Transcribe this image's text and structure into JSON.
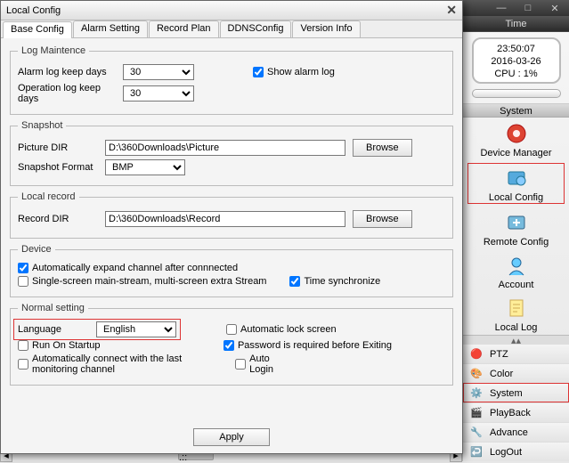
{
  "window": {
    "title": "Local Config",
    "tabs": [
      "Base Config",
      "Alarm Setting",
      "Record Plan",
      "DDNSConfig",
      "Version Info"
    ],
    "active_tab": 0
  },
  "log": {
    "legend": "Log Maintence",
    "alarm_label": "Alarm log keep days",
    "alarm_value": "30",
    "op_label": "Operation log keep days",
    "op_value": "30",
    "show_alarm_label": "Show alarm log",
    "show_alarm_checked": true
  },
  "snapshot": {
    "legend": "Snapshot",
    "dir_label": "Picture DIR",
    "dir_value": "D:\\360Downloads\\Picture",
    "fmt_label": "Snapshot Format",
    "fmt_value": "BMP",
    "browse": "Browse"
  },
  "localrec": {
    "legend": "Local record",
    "dir_label": "Record DIR",
    "dir_value": "D:\\360Downloads\\Record",
    "browse": "Browse"
  },
  "device": {
    "legend": "Device",
    "auto_expand": "Automatically expand channel after connnected",
    "auto_expand_checked": true,
    "single_screen": "Single-screen main-stream, multi-screen extra Stream",
    "single_screen_checked": false,
    "time_sync": "Time synchronize",
    "time_sync_checked": true
  },
  "normal": {
    "legend": "Normal setting",
    "lang_label": "Language",
    "lang_value": "English",
    "auto_lock": "Automatic lock screen",
    "auto_lock_checked": false,
    "run_startup": "Run On Startup",
    "run_startup_checked": false,
    "pwd_exit": "Password is required before Exiting",
    "pwd_exit_checked": true,
    "auto_connect": "Automatically connect with the last monitoring channel",
    "auto_connect_checked": false,
    "auto_login": "Auto Login",
    "auto_login_checked": false
  },
  "apply": "Apply",
  "rp": {
    "time_header": "Time",
    "clock": "23:50:07",
    "date": "2016-03-26",
    "cpu": "CPU : 1%",
    "system_header": "System",
    "items": [
      {
        "label": "Device Manager"
      },
      {
        "label": "Local Config"
      },
      {
        "label": "Remote Config"
      },
      {
        "label": "Account"
      },
      {
        "label": "Local Log"
      }
    ],
    "lower": [
      {
        "label": "PTZ"
      },
      {
        "label": "Color"
      },
      {
        "label": "System"
      },
      {
        "label": "PlayBack"
      },
      {
        "label": "Advance"
      },
      {
        "label": "LogOut"
      }
    ]
  },
  "scroll_marker": ".::"
}
